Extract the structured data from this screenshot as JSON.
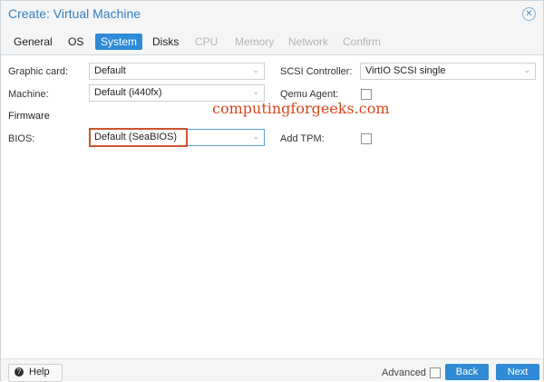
{
  "window": {
    "title": "Create: Virtual Machine"
  },
  "tabs": [
    {
      "label": "General",
      "state": "normal"
    },
    {
      "label": "OS",
      "state": "normal"
    },
    {
      "label": "System",
      "state": "active"
    },
    {
      "label": "Disks",
      "state": "normal"
    },
    {
      "label": "CPU",
      "state": "disabled"
    },
    {
      "label": "Memory",
      "state": "disabled"
    },
    {
      "label": "Network",
      "state": "disabled"
    },
    {
      "label": "Confirm",
      "state": "disabled"
    }
  ],
  "form": {
    "graphic_card": {
      "label": "Graphic card:",
      "value": "Default"
    },
    "machine": {
      "label": "Machine:",
      "value": "Default (i440fx)"
    },
    "firmware_section": "Firmware",
    "bios": {
      "label": "BIOS:",
      "value": "Default (SeaBIOS)"
    },
    "scsi_controller": {
      "label": "SCSI Controller:",
      "value": "VirtIO SCSI single"
    },
    "qemu_agent": {
      "label": "Qemu Agent:",
      "checked": false
    },
    "add_tpm": {
      "label": "Add TPM:",
      "checked": false
    }
  },
  "watermark": "computingforgeeks.com",
  "footer": {
    "help_label": "Help",
    "advanced_label": "Advanced",
    "advanced_checked": false,
    "back_label": "Back",
    "next_label": "Next"
  },
  "icons": {
    "close": "close-icon",
    "chevron": "chevron-down-icon",
    "help": "help-icon"
  },
  "colors": {
    "accent": "#2f8bd5",
    "title": "#2f80c1",
    "highlight_border": "#c9542e",
    "watermark": "#d6461b"
  }
}
